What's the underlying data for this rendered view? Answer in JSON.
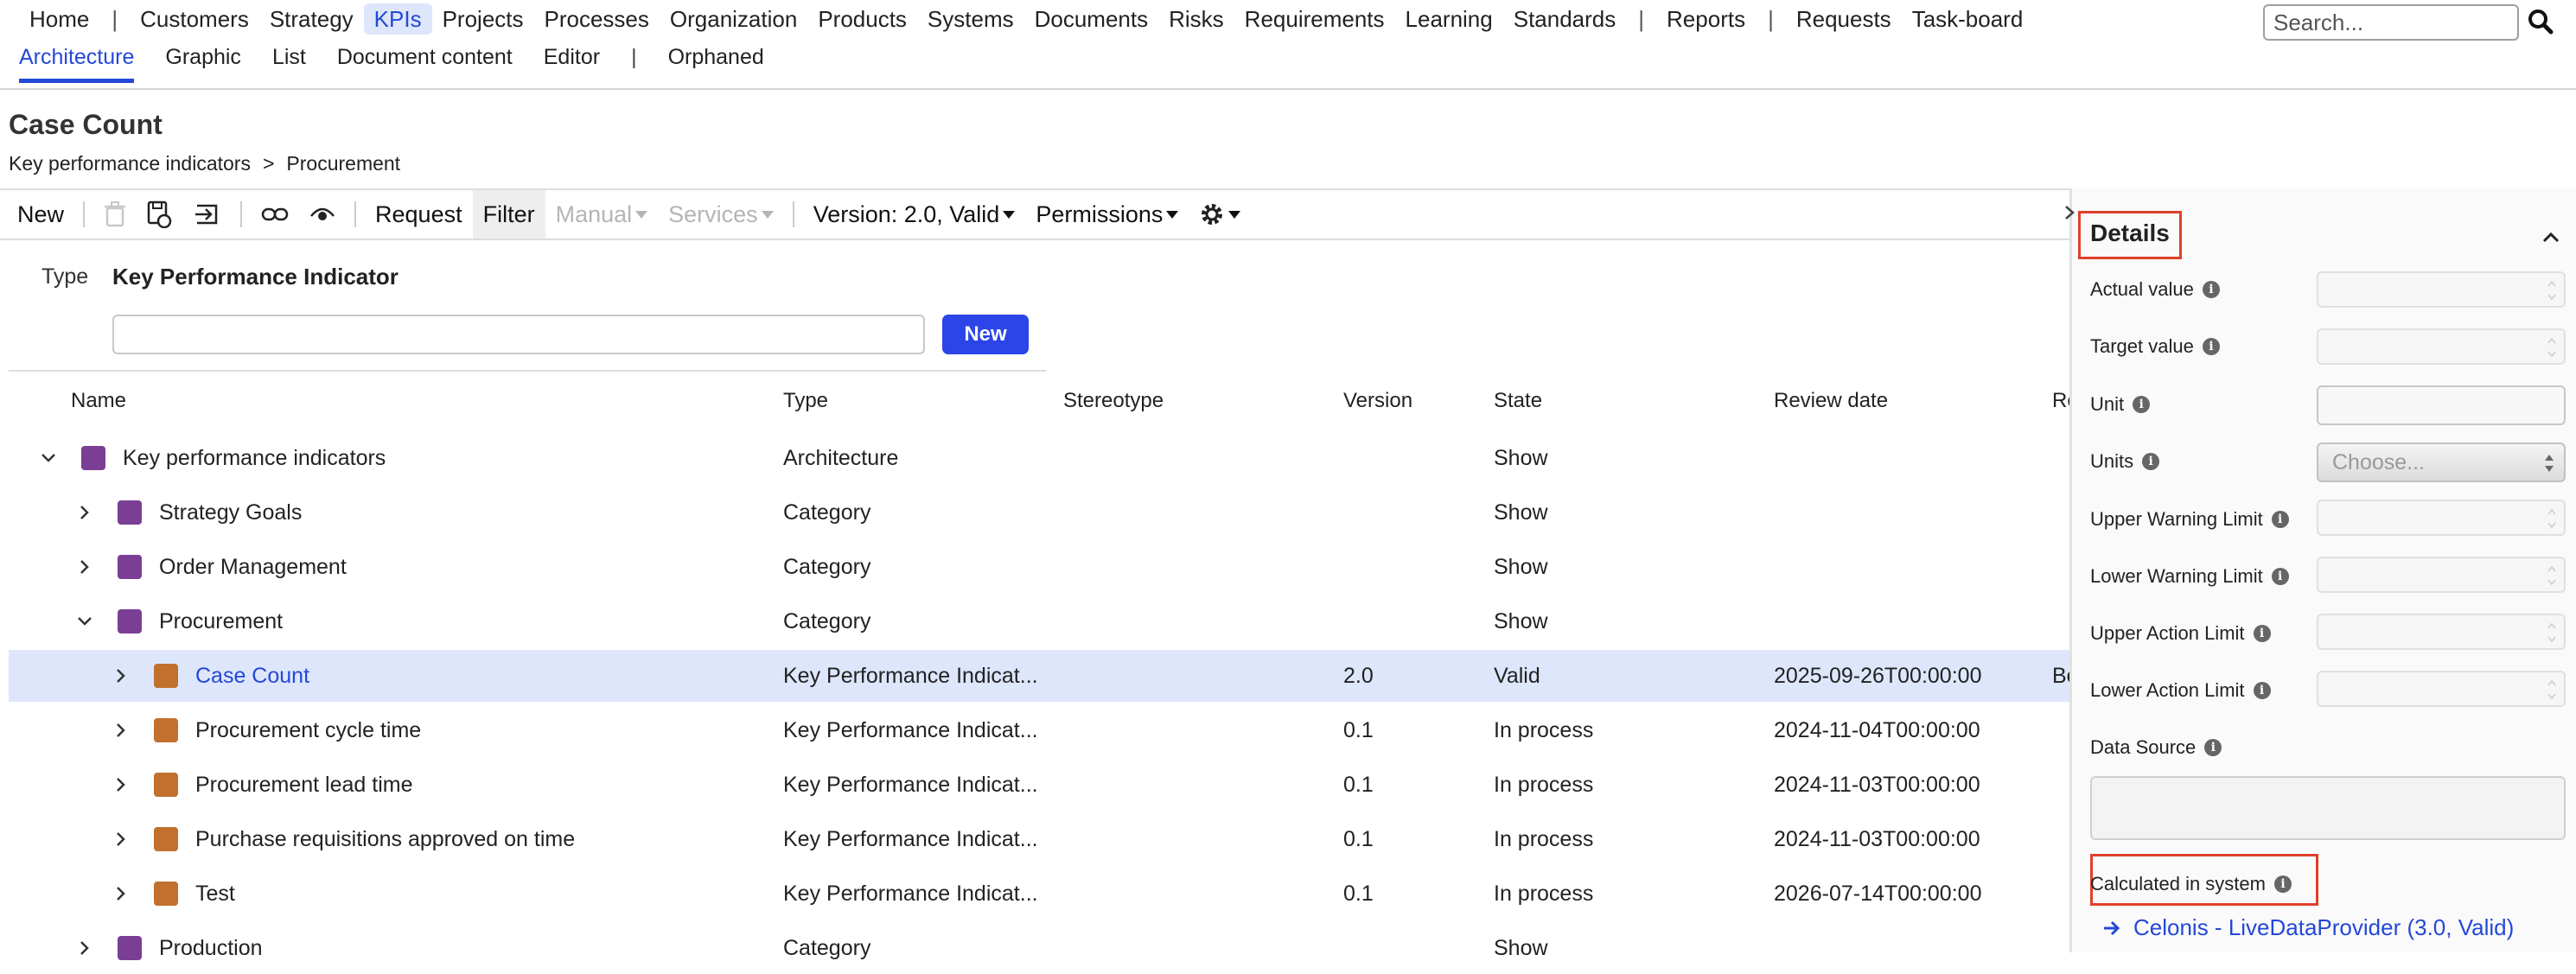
{
  "nav": {
    "items": [
      "Home",
      "|",
      "Customers",
      "Strategy",
      "KPIs",
      "Projects",
      "Processes",
      "Organization",
      "Products",
      "Systems",
      "Documents",
      "Risks",
      "Requirements",
      "Learning",
      "Standards",
      "|",
      "Reports",
      "|",
      "Requests",
      "Task-board"
    ],
    "active": "KPIs",
    "search_placeholder": "Search..."
  },
  "subnav": {
    "items": [
      "Architecture",
      "Graphic",
      "List",
      "Document content",
      "Editor",
      "|",
      "Orphaned"
    ],
    "active": "Architecture"
  },
  "page": {
    "title": "Case Count",
    "breadcrumb": [
      "Key performance indicators",
      ">",
      "Procurement"
    ]
  },
  "toolbar": {
    "new": "New",
    "request": "Request",
    "filter": "Filter",
    "manual": "Manual",
    "services": "Services",
    "version": "Version: 2.0, Valid",
    "permissions": "Permissions"
  },
  "filter_area": {
    "type_label": "Type",
    "type_value": "Key Performance Indicator",
    "new_button": "New"
  },
  "table": {
    "headers": [
      "Name",
      "Type",
      "Stereotype",
      "Version",
      "State",
      "Review date",
      "Re"
    ],
    "rows": [
      {
        "name": "Key performance indicators",
        "type": "Architecture",
        "stereotype": "",
        "version": "",
        "state": "Show",
        "review": "",
        "extra": "",
        "level": 0,
        "expanded": true,
        "color": "purple",
        "selected": false
      },
      {
        "name": "Strategy Goals",
        "type": "Category",
        "stereotype": "",
        "version": "",
        "state": "Show",
        "review": "",
        "extra": "",
        "level": 1,
        "expanded": false,
        "color": "purple",
        "selected": false
      },
      {
        "name": "Order Management",
        "type": "Category",
        "stereotype": "",
        "version": "",
        "state": "Show",
        "review": "",
        "extra": "",
        "level": 1,
        "expanded": false,
        "color": "purple",
        "selected": false
      },
      {
        "name": "Procurement",
        "type": "Category",
        "stereotype": "",
        "version": "",
        "state": "Show",
        "review": "",
        "extra": "",
        "level": 1,
        "expanded": true,
        "color": "purple",
        "selected": false
      },
      {
        "name": "Case Count",
        "type": "Key Performance Indicat...",
        "stereotype": "",
        "version": "2.0",
        "state": "Valid",
        "review": "2025-09-26T00:00:00",
        "extra": "Bo",
        "level": 2,
        "expanded": false,
        "color": "orange",
        "selected": true
      },
      {
        "name": "Procurement cycle time",
        "type": "Key Performance Indicat...",
        "stereotype": "",
        "version": "0.1",
        "state": "In process",
        "review": "2024-11-04T00:00:00",
        "extra": "",
        "level": 2,
        "expanded": false,
        "color": "orange",
        "selected": false
      },
      {
        "name": "Procurement lead time",
        "type": "Key Performance Indicat...",
        "stereotype": "",
        "version": "0.1",
        "state": "In process",
        "review": "2024-11-03T00:00:00",
        "extra": "",
        "level": 2,
        "expanded": false,
        "color": "orange",
        "selected": false
      },
      {
        "name": "Purchase requisitions approved on time",
        "type": "Key Performance Indicat...",
        "stereotype": "",
        "version": "0.1",
        "state": "In process",
        "review": "2024-11-03T00:00:00",
        "extra": "",
        "level": 2,
        "expanded": false,
        "color": "orange",
        "selected": false
      },
      {
        "name": "Test",
        "type": "Key Performance Indicat...",
        "stereotype": "",
        "version": "0.1",
        "state": "In process",
        "review": "2026-07-14T00:00:00",
        "extra": "",
        "level": 2,
        "expanded": false,
        "color": "orange",
        "selected": false
      },
      {
        "name": "Production",
        "type": "Category",
        "stereotype": "",
        "version": "",
        "state": "Show",
        "review": "",
        "extra": "",
        "level": 1,
        "expanded": false,
        "color": "purple",
        "selected": false
      }
    ]
  },
  "details": {
    "title": "Details",
    "fields": {
      "actual_value": "Actual value",
      "target_value": "Target value",
      "unit": "Unit",
      "units": "Units",
      "units_placeholder": "Choose...",
      "upper_warning": "Upper Warning Limit",
      "lower_warning": "Lower Warning Limit",
      "upper_action": "Upper Action Limit",
      "lower_action": "Lower Action Limit",
      "data_source": "Data Source",
      "calculated": "Calculated in system"
    },
    "link": "Celonis - LiveDataProvider (3.0, Valid)"
  },
  "colors": {
    "accent": "#2448d8",
    "highlight": "#e0402a",
    "selected_row": "#dde6fb",
    "category_square": "#7a3f95",
    "kpi_square": "#c1702e"
  }
}
